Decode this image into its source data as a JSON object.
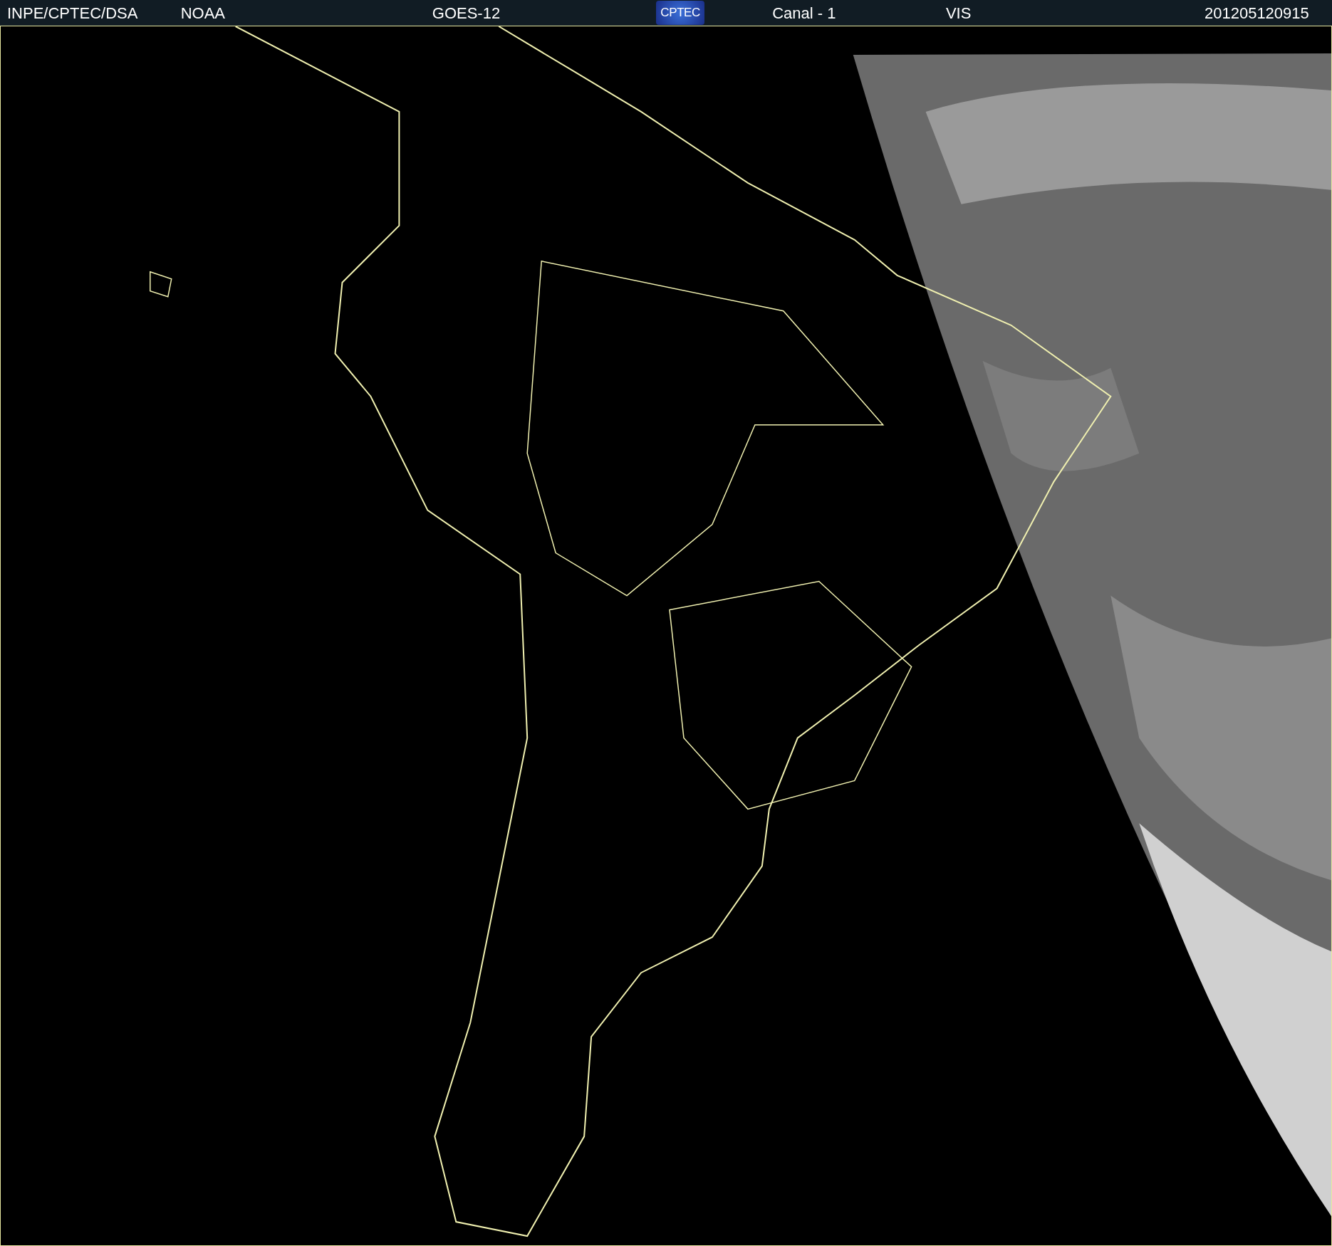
{
  "header": {
    "items": [
      {
        "kind": "text",
        "text": "INPE/CPTEC/DSA"
      },
      {
        "kind": "text",
        "text": "NOAA"
      },
      {
        "kind": "text",
        "text": "GOES-12"
      },
      {
        "kind": "logo",
        "text": "CPTEC"
      },
      {
        "kind": "text",
        "text": "Canal - 1"
      },
      {
        "kind": "text",
        "text": "VIS"
      },
      {
        "kind": "text",
        "text": "201205120915"
      }
    ]
  }
}
